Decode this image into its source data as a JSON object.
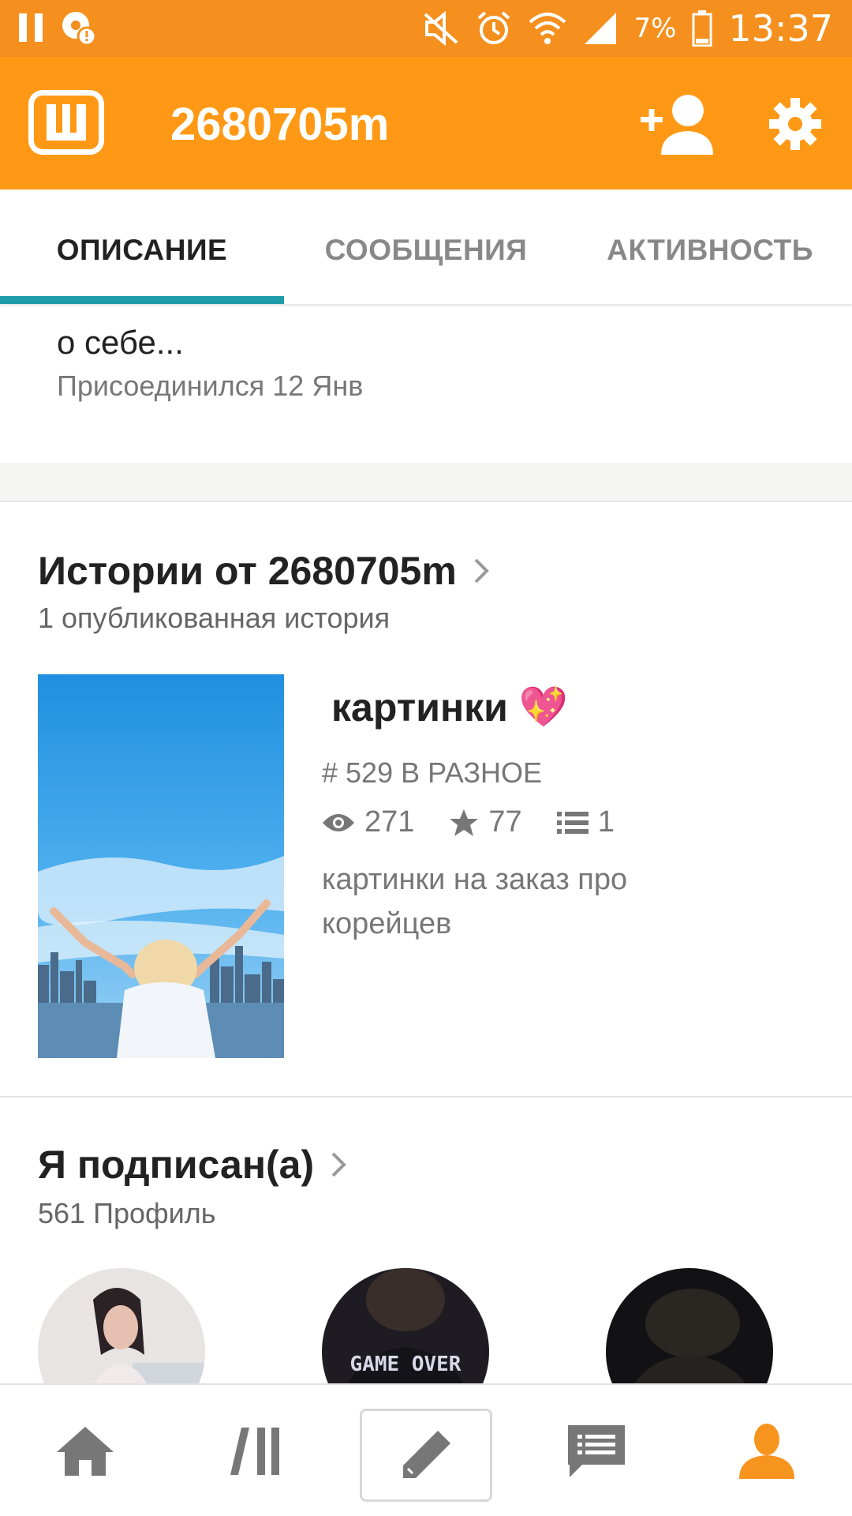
{
  "status_bar": {
    "time": "13:37",
    "battery_percent": "7%",
    "icons": [
      "pause-icon",
      "notification-alert-icon",
      "mute-icon",
      "alarm-icon",
      "wifi-icon",
      "signal-icon",
      "battery-icon"
    ]
  },
  "app_bar": {
    "logo_letter": "Ш",
    "title": "2680705m",
    "icons": [
      "add-user-icon",
      "settings-icon"
    ]
  },
  "tabs": [
    {
      "label": "ОПИСАНИЕ",
      "active": true
    },
    {
      "label": "СООБЩЕНИЯ",
      "active": false
    },
    {
      "label": "АКТИВНОСТЬ",
      "active": false
    }
  ],
  "description": {
    "about_text": "о себе...",
    "joined_text": "Присоединился 12 Янв"
  },
  "stories_section": {
    "title": "Истории от 2680705m",
    "subtitle": "1 опубликованная история",
    "story": {
      "title": "картинки",
      "emoji": "💖",
      "tag": "# 529 В РАЗНОЕ",
      "views": "271",
      "votes": "77",
      "parts": "1",
      "description": "картинки на заказ про корейцев"
    }
  },
  "following_section": {
    "title": "Я подписан(а)",
    "subtitle": "561 Профиль",
    "avatar_count": 3,
    "avatar2_text": "GAME OVER"
  },
  "bottom_nav": {
    "items": [
      "home-icon",
      "library-icon",
      "write-icon",
      "messages-icon",
      "profile-icon"
    ],
    "active": "profile-icon"
  },
  "colors": {
    "status_bar": "#f5901e",
    "app_bar": "#ff9915",
    "tab_indicator": "#1f9ba8",
    "active_nav": "#f7941d"
  }
}
